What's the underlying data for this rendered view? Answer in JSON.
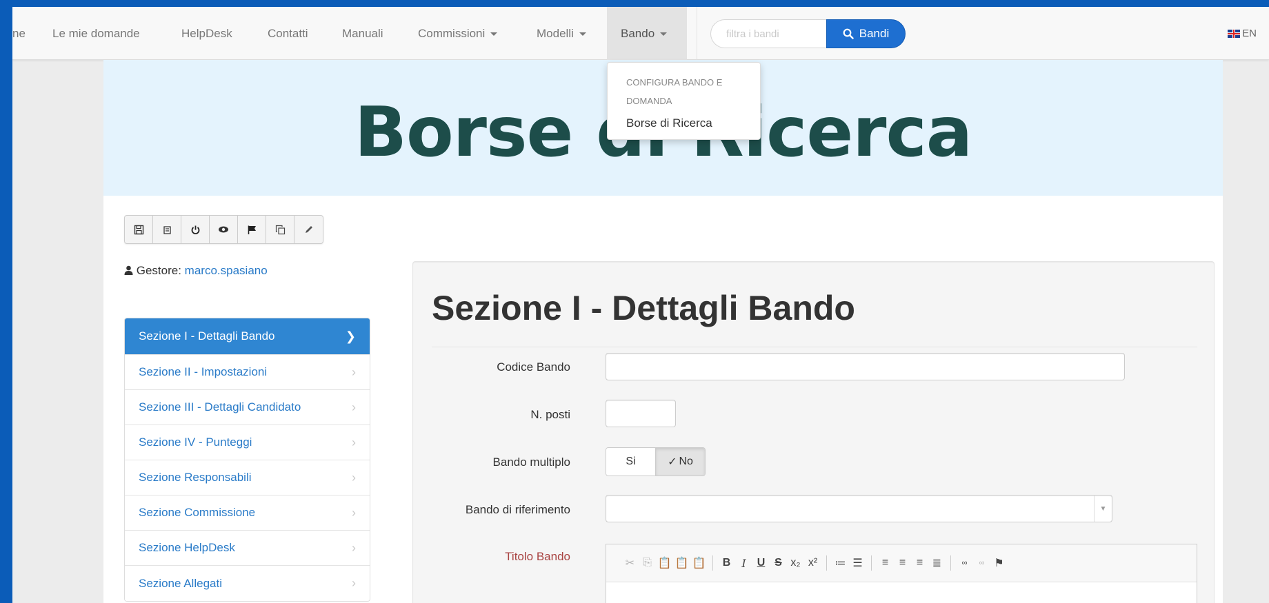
{
  "nav": {
    "items": [
      {
        "label": "ne"
      },
      {
        "label": "Le mie domande"
      },
      {
        "label": "HelpDesk"
      },
      {
        "label": "Contatti"
      },
      {
        "label": "Manuali"
      },
      {
        "label": "Commissioni"
      },
      {
        "label": "Modelli"
      },
      {
        "label": "Bando"
      }
    ],
    "search_placeholder": "filtra i bandi",
    "search_button": "Bandi",
    "lang": "EN"
  },
  "dropdown": {
    "header": "Configura bando e domanda",
    "item": "Borse di Ricerca"
  },
  "banner": {
    "title": "Borse di Ricerca"
  },
  "toolbar": {
    "icons": [
      "save-icon",
      "archive-icon",
      "power-icon",
      "eye-icon",
      "flag-icon",
      "copy-icon",
      "pencil-icon"
    ]
  },
  "manager": {
    "label": "Gestore:",
    "user": "marco.spasiano"
  },
  "sidebar": {
    "items": [
      {
        "label": "Sezione I - Dettagli Bando"
      },
      {
        "label": "Sezione II - Impostazioni"
      },
      {
        "label": "Sezione III - Dettagli Candidato"
      },
      {
        "label": "Sezione IV - Punteggi"
      },
      {
        "label": "Sezione Responsabili"
      },
      {
        "label": "Sezione Commissione"
      },
      {
        "label": "Sezione HelpDesk"
      },
      {
        "label": "Sezione Allegati"
      }
    ]
  },
  "form": {
    "title": "Sezione I - Dettagli Bando",
    "codice_label": "Codice Bando",
    "codice_value": "",
    "posti_label": "N. posti",
    "posti_value": "",
    "multiplo_label": "Bando multiplo",
    "multiplo_yes": "Si",
    "multiplo_no": "No",
    "riferimento_label": "Bando di riferimento",
    "titolo_label": "Titolo Bando"
  },
  "colors": {
    "accent": "#2f86d2",
    "search_button": "#1e6fd1",
    "banner_bg": "#e4f3fd",
    "banner_text": "#1d4d4a",
    "required_label": "#a94442",
    "frame": "#0b5cb8"
  }
}
